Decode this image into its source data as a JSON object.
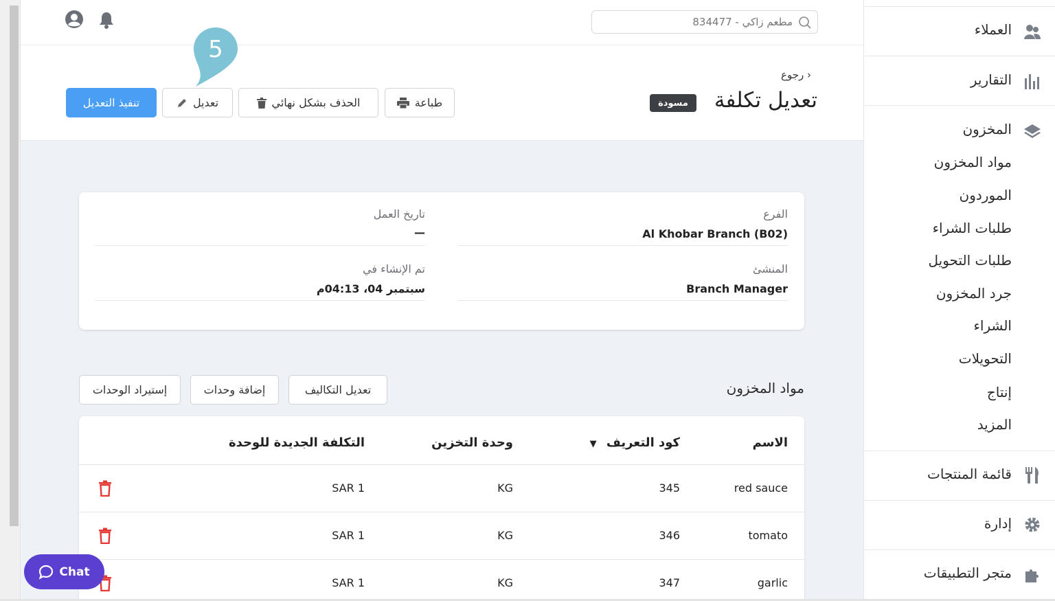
{
  "header": {
    "search_placeholder": "مطعم زاكي - 834477"
  },
  "page": {
    "back_label": "رجوع",
    "title": "تعديل تكلفة",
    "status_badge": "مسودة",
    "step_number": "5"
  },
  "actions": {
    "print": "طباعة",
    "delete_permanently": "الحذف بشكل نهائي",
    "edit": "تعديل",
    "submit": "تنفيذ التعديل"
  },
  "details": {
    "branch_label": "الفرع",
    "branch_value": "Al Khobar Branch (B02)",
    "business_date_label": "تاريخ العمل",
    "business_date_value": "—",
    "creator_label": "المنشئ",
    "creator_value": "Branch Manager",
    "created_at_label": "تم الإنشاء في",
    "created_at_value": "سبتمبر 04، 04:13م"
  },
  "items_section": {
    "title": "مواد المخزون",
    "edit_costs": "تعديل التكاليف",
    "add_items": "إضافة وحدات",
    "import_items": "إستيراد الوحدات"
  },
  "table": {
    "headers": {
      "name": "الاسم",
      "sku": "كود التعريف",
      "storage_unit": "وحدة التخزين",
      "new_unit_cost": "التكلفة الجديدة للوحدة"
    },
    "rows": [
      {
        "name": "red sauce",
        "sku": "345",
        "unit": "KG",
        "cost": "SAR 1"
      },
      {
        "name": "tomato",
        "sku": "346",
        "unit": "KG",
        "cost": "SAR 1"
      },
      {
        "name": "garlic",
        "sku": "347",
        "unit": "KG",
        "cost": "SAR 1"
      }
    ]
  },
  "sidebar": {
    "customers": "العملاء",
    "reports": "التقارير",
    "inventory": "المخزون",
    "inventory_items": "مواد المخزون",
    "suppliers": "الموردون",
    "purchase_orders": "طلبات الشراء",
    "transfer_orders": "طلبات التحويل",
    "inventory_count": "جرد المخزون",
    "purchasing": "الشراء",
    "transfers": "التحويلات",
    "production": "إنتاج",
    "more": "المزيد",
    "menu": "قائمة المنتجات",
    "manage": "إدارة",
    "marketplace": "متجر التطبيقات"
  },
  "chat": {
    "label": "Chat"
  },
  "colors": {
    "primary": "#4a9ff5",
    "badge": "#3c3f44",
    "delete": "#e53935",
    "chat": "#5b3fd1",
    "step_bubble": "#7ec3d6"
  }
}
